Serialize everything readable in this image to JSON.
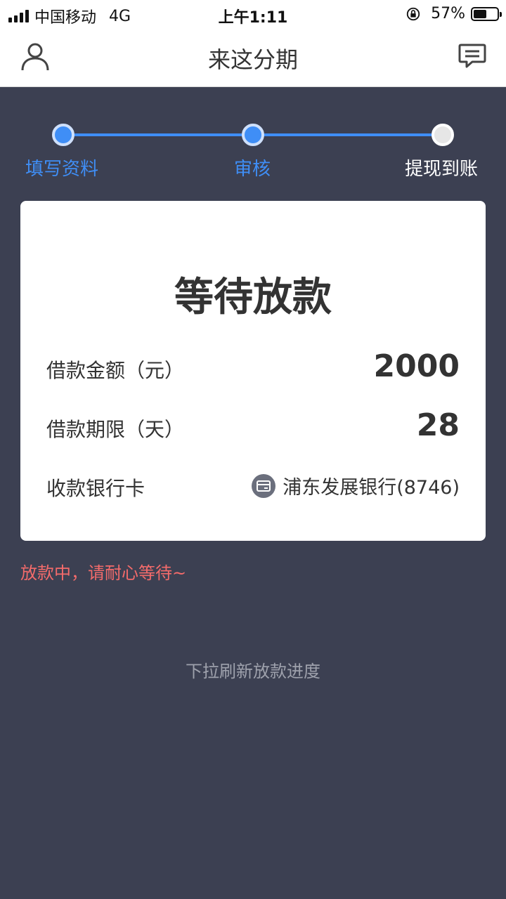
{
  "status_bar": {
    "carrier": "中国移动",
    "network": "4G",
    "time": "上午1:11",
    "battery": "57%",
    "battery_level": 0.57
  },
  "nav": {
    "title": "来这分期",
    "icons": [
      "user-icon",
      "message-icon"
    ]
  },
  "steps": [
    {
      "label": "填写资料",
      "state": "done"
    },
    {
      "label": "审核",
      "state": "done"
    },
    {
      "label": "提现到账",
      "state": "pending"
    }
  ],
  "card": {
    "title": "等待放款",
    "amount_label": "借款金额（元）",
    "amount_value": "2000",
    "term_label": "借款期限（天）",
    "term_value": "28",
    "bank_label": "收款银行卡",
    "bank_value": "浦东发展银行(8746)",
    "bank_icon": "card-icon"
  },
  "notice": "放款中，请耐心等待~",
  "refresh_hint": "下拉刷新放款进度",
  "colors": {
    "accent": "#3f8ef6",
    "background": "#3c4052",
    "notice": "#f46b6b"
  }
}
